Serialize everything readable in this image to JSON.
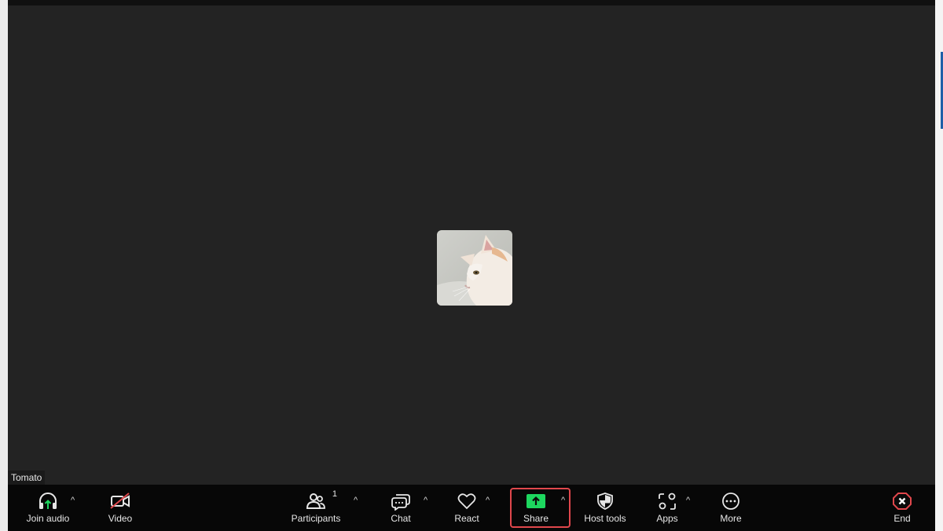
{
  "participant": {
    "name": "Tomato"
  },
  "toolbar": {
    "join_audio": "Join audio",
    "video": "Video",
    "participants": "Participants",
    "participants_count": "1",
    "chat": "Chat",
    "react": "React",
    "share": "Share",
    "host_tools": "Host tools",
    "apps": "Apps",
    "more": "More",
    "end": "End"
  },
  "colors": {
    "share_accent": "#1dd75f",
    "end_accent": "#e0474c",
    "video_off": "#e0474c",
    "audio_arrow": "#1dd75f"
  }
}
